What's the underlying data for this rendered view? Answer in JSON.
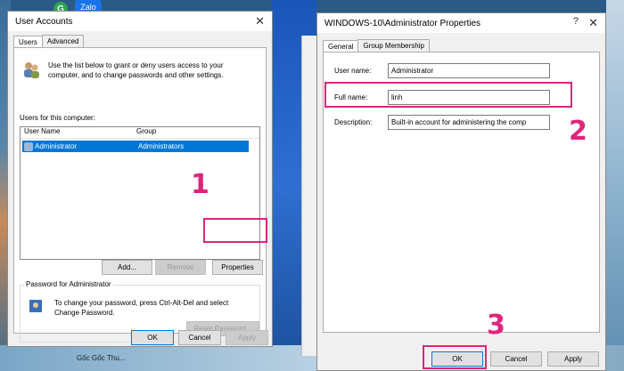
{
  "desktop": {
    "icon_label": "Zalo",
    "tray_items": [
      "Gốc Gốc",
      "Thu..."
    ]
  },
  "user_accounts": {
    "title": "User Accounts",
    "tabs": [
      "Users",
      "Advanced"
    ],
    "intro": "Use the list below to grant or deny users access to your computer, and to change passwords and other settings.",
    "users_label": "Users for this computer:",
    "columns": [
      "User Name",
      "Group"
    ],
    "rows": [
      {
        "user": "Administrator",
        "group": "Administrators"
      }
    ],
    "buttons": {
      "add": "Add...",
      "remove": "Remove",
      "properties": "Properties"
    },
    "password_group": "Password for Administrator",
    "password_text": "To change your password, press Ctrl-Alt-Del and select Change Password.",
    "reset_password": "Reset Password...",
    "footer": {
      "ok": "OK",
      "cancel": "Cancel",
      "apply": "Apply"
    }
  },
  "properties": {
    "title": "WINDOWS-10\\Administrator Properties",
    "tabs": [
      "General",
      "Group Membership"
    ],
    "fields": {
      "user_name_label": "User name:",
      "user_name_value": "Administrator",
      "full_name_label": "Full name:",
      "full_name_value": "linh",
      "description_label": "Description:",
      "description_value": "Built-in account for administering the comp"
    },
    "footer": {
      "ok": "OK",
      "cancel": "Cancel",
      "apply": "Apply"
    }
  },
  "annotations": {
    "step1": "1",
    "step2": "2",
    "step3": "3"
  },
  "colors": {
    "highlight": "#e0247c",
    "selection": "#0078d7"
  }
}
